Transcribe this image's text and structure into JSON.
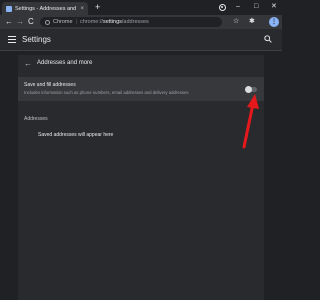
{
  "browser": {
    "tab_title": "Settings - Addresses and more",
    "tab_close": "×",
    "new_tab": "+",
    "window_controls": {
      "minimize": "–",
      "maximize": "□",
      "close": "✕"
    },
    "nav": {
      "back": "←",
      "forward": "→",
      "reload": "C"
    },
    "omnibox": {
      "chip": "Chrome",
      "separator": "|",
      "scheme": "chrome://",
      "host": "settings",
      "path": "/addresses"
    },
    "toolbar_icons": {
      "bookmark": "☆",
      "extensions": "✱"
    }
  },
  "settings": {
    "header_title": "Settings",
    "page_title": "Addresses and more",
    "save_toggle": {
      "title": "Save and fill addresses",
      "description": "Includes information such as phone numbers, email addresses and delivery addresses",
      "enabled": false
    },
    "addresses_label": "Addresses",
    "empty_message": "Saved addresses will appear here"
  },
  "colors": {
    "annotation_arrow": "#e5191b",
    "background": "#202124",
    "card": "#292a2d"
  }
}
